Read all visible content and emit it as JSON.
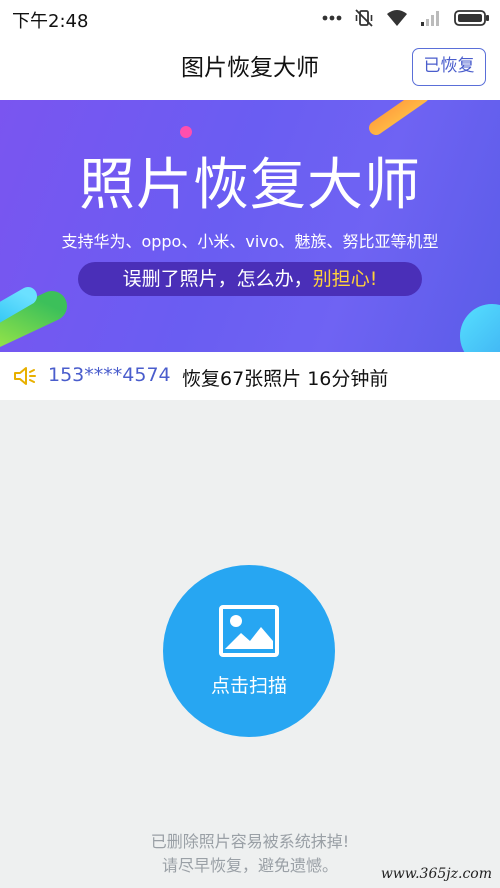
{
  "status_bar": {
    "time": "下午2:48",
    "icons": [
      "more-dots-icon",
      "mute-vibrate-icon",
      "wifi-icon",
      "signal-icon",
      "battery-icon"
    ]
  },
  "header": {
    "title": "图片恢复大师",
    "recovered_button": "已恢复"
  },
  "banner": {
    "title": "照片恢复大师",
    "subtitle": "支持华为、oppo、小米、vivo、魅族、努比亚等机型",
    "pill_prefix": "误删了照片，怎么办，",
    "pill_highlight": "别担心!"
  },
  "ticker": {
    "icon": "speaker-icon",
    "phone": "153****4574",
    "message": "恢复67张照片   16分钟前"
  },
  "scan": {
    "icon": "image-icon",
    "label": "点击扫描"
  },
  "footer": {
    "line1": "已删除照片容易被系统抹掉!",
    "line2": "请尽早恢复，避免遗憾。"
  },
  "watermark": "www.365jz.com",
  "colors": {
    "accent_blue": "#27a6f2",
    "brand_indigo": "#4a5dcc",
    "banner_purple": "#6a5df2",
    "highlight_yellow": "#ffd23a",
    "background": "#eef0f0"
  }
}
